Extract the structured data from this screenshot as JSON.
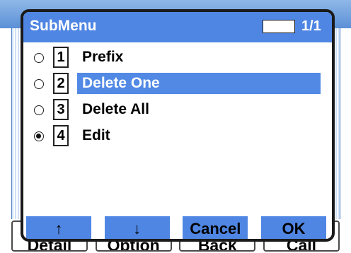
{
  "background_softkeys": [
    {
      "label": "Detail"
    },
    {
      "label": "Option"
    },
    {
      "label": "Back"
    },
    {
      "label": "Call"
    }
  ],
  "popup": {
    "title": "SubMenu",
    "page_indicator": "1/1",
    "items": [
      {
        "number": "1",
        "label": "Prefix",
        "radio_selected": false,
        "highlighted": false
      },
      {
        "number": "2",
        "label": "Delete One",
        "radio_selected": false,
        "highlighted": true
      },
      {
        "number": "3",
        "label": "Delete All",
        "radio_selected": false,
        "highlighted": false
      },
      {
        "number": "4",
        "label": "Edit",
        "radio_selected": true,
        "highlighted": false
      }
    ],
    "softkeys": [
      {
        "label": "↑",
        "icon": "arrow-up-icon"
      },
      {
        "label": "↓",
        "icon": "arrow-down-icon"
      },
      {
        "label": "Cancel"
      },
      {
        "label": "OK"
      }
    ]
  },
  "colors": {
    "header_bg": "#4f86e3",
    "highlight_bg": "#5189e5",
    "softkey_bg": "#4f86e3"
  }
}
